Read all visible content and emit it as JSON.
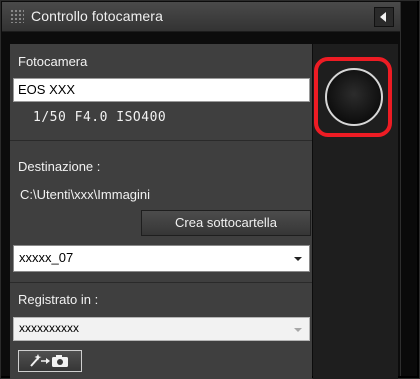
{
  "window": {
    "title": "Controllo fotocamera"
  },
  "camera": {
    "section_label": "Fotocamera",
    "model": "EOS XXX",
    "settings": "1/50  F4.0  ISO400"
  },
  "destination": {
    "label": "Destinazione :",
    "path": "C:\\Utenti\\xxx\\Immagini",
    "create_subfolder_label": "Crea sottocartella",
    "folder_selected": "xxxxx_07"
  },
  "saved_in": {
    "label": "Registrato in :",
    "selected": "xxxxxxxxxx"
  },
  "icons": {
    "grip": "grip-dots-icon",
    "collapse": "collapse-left-icon",
    "tool": "wand-arrow-camera-icon"
  },
  "colors": {
    "highlight": "#ee1c24",
    "panel": "#3f3f3f"
  }
}
